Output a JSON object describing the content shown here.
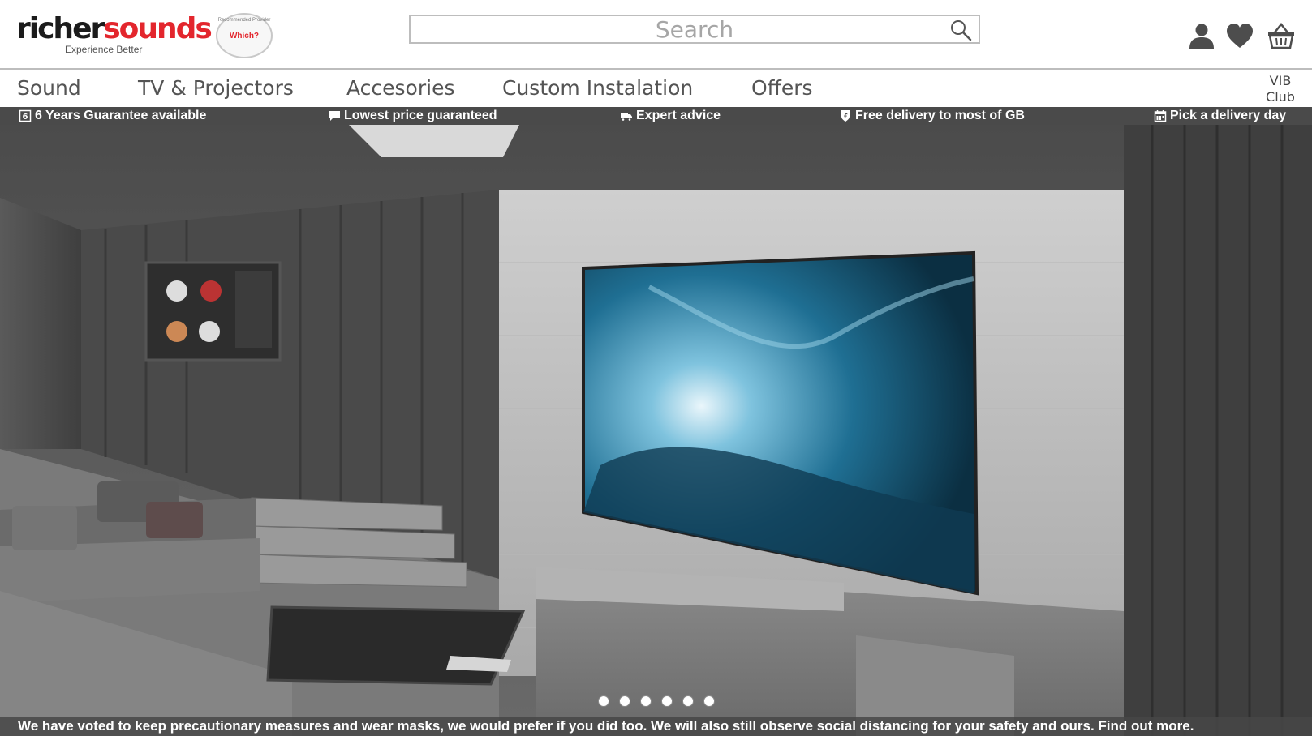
{
  "brand": {
    "logo_part1": "richer",
    "logo_part2": "sounds",
    "tagline": "Experience Better",
    "badge_ring": "Recommended Provider",
    "badge_text": "Which?"
  },
  "search": {
    "placeholder": "Search"
  },
  "header_icons": [
    "user-icon",
    "heart-icon",
    "basket-icon"
  ],
  "nav": {
    "items": [
      {
        "label": "Sound"
      },
      {
        "label": "TV & Projectors"
      },
      {
        "label": "Accesories"
      },
      {
        "label": "Custom Instalation"
      },
      {
        "label": "Offers"
      }
    ],
    "vib_line1": "VIB",
    "vib_line2": "Club"
  },
  "usp": [
    {
      "label": "6 Years Guarantee available",
      "icon": "guarantee-icon"
    },
    {
      "label": "Lowest price guaranteed",
      "icon": "speech-bubble-icon"
    },
    {
      "label": "Expert advice",
      "icon": "truck-icon"
    },
    {
      "label": "Free delivery to most of GB",
      "icon": "shield-pound-icon"
    },
    {
      "label": "Pick a delivery day",
      "icon": "calendar-icon"
    }
  ],
  "carousel": {
    "slides": 6,
    "active": 1
  },
  "banner": {
    "text": "We have voted to keep precautionary measures and wear masks, we would prefer if you did too. We will also still observe social distancing for your safety and ours. Find out more."
  },
  "colors": {
    "brand_red": "#e3262d",
    "usp_bg": "#4a4a4a",
    "nav_text": "#545454"
  }
}
